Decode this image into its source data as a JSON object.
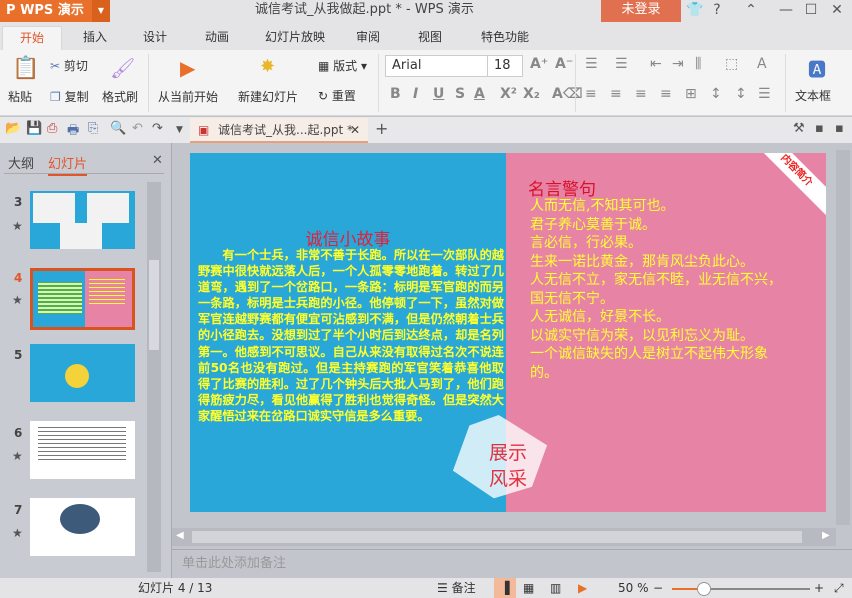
{
  "app": {
    "name": "WPS 演示",
    "title": "诚信考试_从我做起.ppt * - WPS 演示",
    "login": "未登录",
    "accent": "#e8702a"
  },
  "tabs": [
    "开始",
    "插入",
    "设计",
    "动画",
    "幻灯片放映",
    "审阅",
    "视图",
    "特色功能"
  ],
  "ribbon": {
    "paste": "粘贴",
    "cut": "剪切",
    "copy": "复制",
    "format_painter": "格式刷",
    "from_current": "从当前开始",
    "new_slide": "新建幻灯片",
    "layout": "版式",
    "reset": "重置",
    "font": "Arial",
    "font_size": "18",
    "textbox": "文本框"
  },
  "doc_tab": {
    "label": "诚信考试_从我...起.ppt *"
  },
  "left_panel": {
    "tab_outline": "大纲",
    "tab_slides": "幻灯片",
    "slides": [
      {
        "num": "3"
      },
      {
        "num": "4",
        "selected": true
      },
      {
        "num": "5"
      },
      {
        "num": "6"
      },
      {
        "num": "7"
      }
    ]
  },
  "slide": {
    "story_title": "诚信小故事",
    "story": "有一个士兵，非常不善于长跑。所以在一次部队的越野赛中很快就远落人后，一个人孤零零地跑着。转过了几道弯，遇到了一个岔路口，一条路：标明是军官跑的而另一条路，标明是士兵跑的小径。他停顿了一下，虽然对做军官连越野赛都有便宜可沾感到不满，但是仍然朝着士兵的小径跑去。没想到过了半个小时后到达终点，却是名列第一。他感到不可思议。自己从来没有取得过名次不说连前50名也没有跑过。但是主持赛跑的军官笑着恭喜他取得了比赛的胜利。过了几个钟头后大批人马到了，他们跑得筋疲力尽，看见他赢得了胜利也觉得奇怪。但是突然大家醒悟过来在岔路口诚实守信是多么重要。",
    "quotes_title": "名言警句",
    "quotes": "人而无信,不知其可也。\n君子养心莫善于诚。\n言必信，行必果。\n生来一诺比黄金，那肯风尘负此心。\n人无信不立，家无信不睦，业无信不兴，国无信不宁。\n人无诚信，好景不长。\n以诚实守信为荣，以见利忘义为耻。\n一个诚信缺失的人是树立不起伟大形象的。",
    "badge": "展示\n风采",
    "corner": "内容简介"
  },
  "notes_placeholder": "单击此处添加备注",
  "status": {
    "slide_info": "幻灯片 4 / 13",
    "notes": "备注",
    "zoom": "50 %",
    "zoom_value": 50
  }
}
